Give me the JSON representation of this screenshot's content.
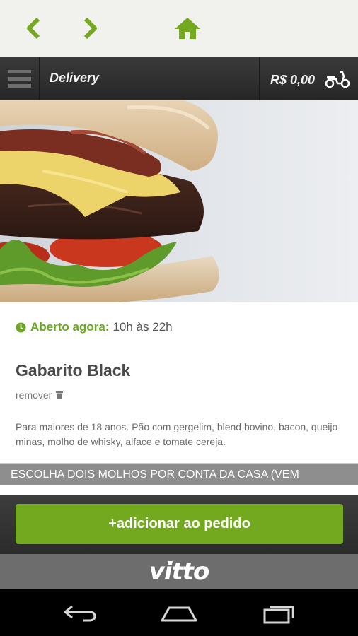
{
  "browser": {
    "back_icon": "chevron-left-icon",
    "forward_icon": "chevron-right-icon",
    "home_icon": "home-icon"
  },
  "header": {
    "title": "Delivery",
    "cart_total": "R$ 0,00",
    "menu_icon": "hamburger-menu-icon",
    "delivery_icon": "scooter-icon"
  },
  "status": {
    "label": "Aberto agora:",
    "hours": "10h às 22h"
  },
  "product": {
    "name": "Gabarito Black",
    "remove_label": "remover",
    "description": "Para maiores de 18 anos. Pão com gergelim, blend bovino, bacon, queijo minas, molho de whisky, alface e tomate cereja."
  },
  "section": {
    "title": "ESCOLHA DOIS MOLHOS POR CONTA DA CASA (VEM"
  },
  "actions": {
    "add_label": "+adicionar ao pedido"
  },
  "brand": {
    "logo": "vitto"
  },
  "colors": {
    "accent": "#72a91f",
    "header_dark": "#2b2b2b",
    "section_gray": "#8e8e8e"
  }
}
